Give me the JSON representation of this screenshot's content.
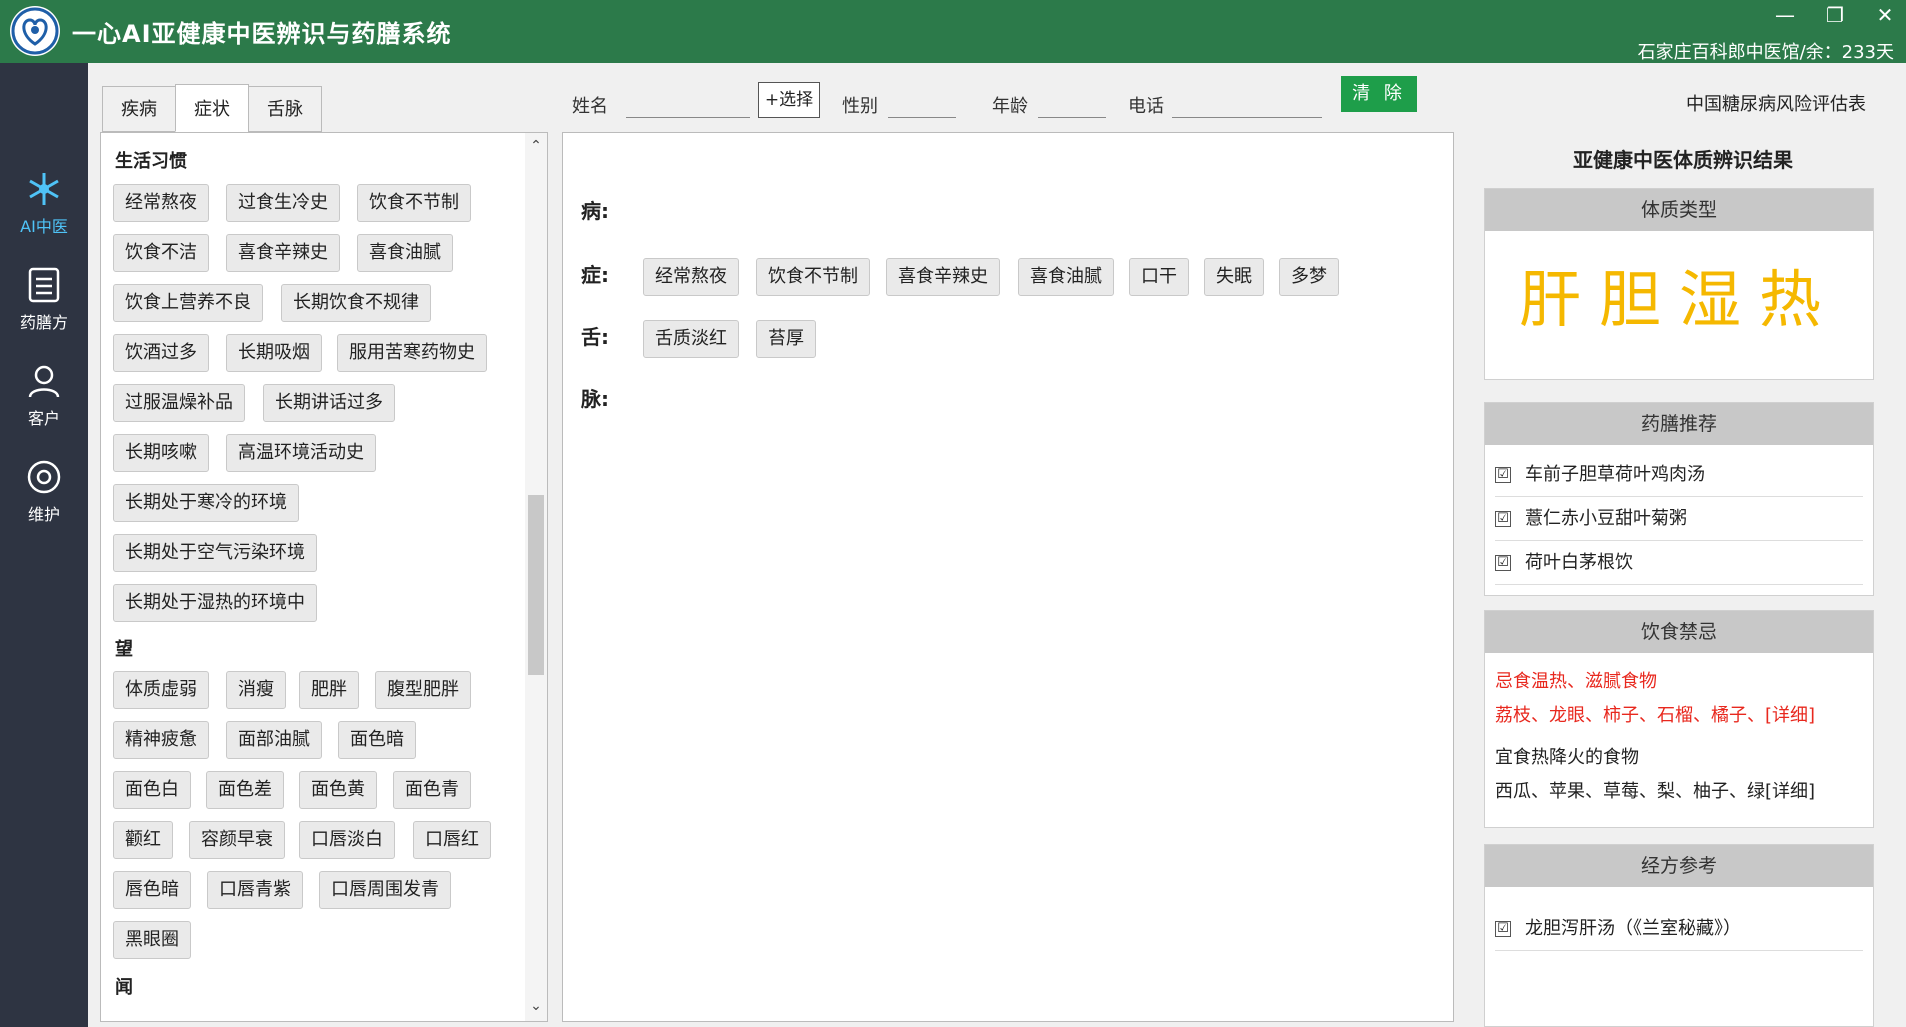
{
  "app": {
    "title": "一心AI亚健康中医辨识与药膳系统",
    "license": "石家庄百科郎中医馆/余：233天",
    "window_controls": [
      "—",
      "❐",
      "✕"
    ]
  },
  "sidebar": {
    "items": [
      {
        "label": "AI中医",
        "icon": "ai-spark-icon",
        "active": true
      },
      {
        "label": "药膳方",
        "icon": "list-icon"
      },
      {
        "label": "客户",
        "icon": "user-icon"
      },
      {
        "label": "维护",
        "icon": "gear-icon"
      }
    ]
  },
  "tabs": [
    "疾病",
    "症状",
    "舌脉"
  ],
  "symptom_panel": {
    "sections": [
      {
        "title": "生活习惯",
        "chips": [
          "经常熬夜",
          "过食生冷史",
          "饮食不节制",
          "饮食不洁",
          "喜食辛辣史",
          "喜食油腻",
          "饮食上营养不良",
          "长期饮食不规律",
          "饮酒过多",
          "长期吸烟",
          "服用苦寒药物史",
          "过服温燥补品",
          "长期讲话过多",
          "长期咳嗽",
          "高温环境活动史",
          "长期处于寒冷的环境",
          "长期处于空气污染环境",
          "长期处于湿热的环境中"
        ]
      },
      {
        "title": "望",
        "chips": [
          "体质虚弱",
          "消瘦",
          "肥胖",
          "腹型肥胖",
          "精神疲惫",
          "面部油腻",
          "面色暗",
          "面色白",
          "面色差",
          "面色黄",
          "面色青",
          "颧红",
          "容颜早衰",
          "口唇淡白",
          "口唇红",
          "唇色暗",
          "口唇青紫",
          "口唇周围发青",
          "黑眼圈"
        ]
      },
      {
        "title": "闻",
        "chips": []
      }
    ],
    "scroll_up": "⌃",
    "scroll_down": "⌄"
  },
  "form": {
    "name_label": "姓名",
    "select_label": "+选择",
    "gender_label": "性别",
    "age_label": "年龄",
    "phone_label": "电话",
    "name_value": "",
    "gender_value": "",
    "age_value": "",
    "phone_value": "",
    "clear_label": "清 除",
    "risk_link": "中国糖尿病风险评估表"
  },
  "selected": {
    "disease_label": "病:",
    "symptom_label": "症:",
    "tongue_label": "舌:",
    "pulse_label": "脉:",
    "symptoms": [
      "经常熬夜",
      "饮食不节制",
      "喜食辛辣史",
      "喜食油腻",
      "口干",
      "失眠",
      "多梦"
    ],
    "tongue": [
      "舌质淡红",
      "苔厚"
    ]
  },
  "result": {
    "title": "亚健康中医体质辨识结果",
    "constitution_head": "体质类型",
    "constitution": "肝胆湿热",
    "recipe_head": "药膳推荐",
    "recipes": [
      "车前子胆草荷叶鸡肉汤",
      "薏仁赤小豆甜叶菊粥",
      "荷叶白茅根饮"
    ],
    "diet_head": "饮食禁忌",
    "avoid_line1": "忌食温热、滋腻食物",
    "avoid_line2": "荔枝、龙眼、柿子、石榴、橘子、[详细]",
    "suit_line1": "宜食热降火的食物",
    "suit_line2": "西瓜、苹果、草莓、梨、柚子、绿[详细]",
    "formula_head": "经方参考",
    "formulas": [
      "龙胆泻肝汤（《兰室秘藏》）"
    ],
    "check_mark": "☑"
  },
  "colors": {
    "titlebar": "#2c7a4a",
    "sidebar": "#2e3442",
    "accent": "#4fc3f7",
    "clear_button": "#1e9e4a",
    "constitution_text": "#f5b800",
    "avoid_text": "#e8281e"
  }
}
